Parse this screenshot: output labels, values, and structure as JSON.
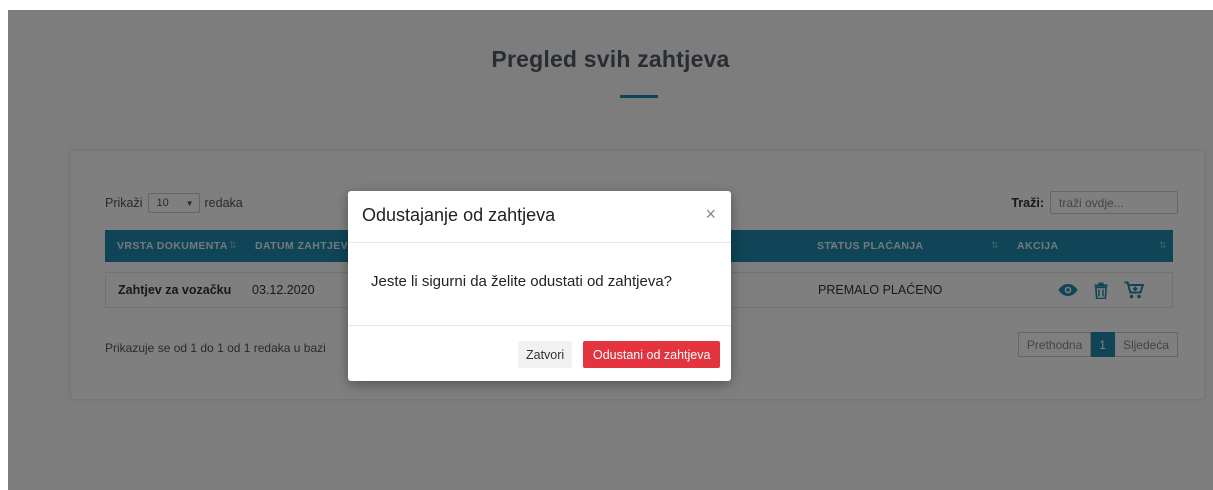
{
  "page": {
    "title": "Pregled svih zahtjeva"
  },
  "table": {
    "length": {
      "prefix": "Prikaži",
      "value": "10",
      "suffix": "redaka"
    },
    "search": {
      "label": "Traži:",
      "placeholder": "traži ovdje..."
    },
    "columns": [
      "VRSTA DOKUMENTA",
      "DATUM ZAHTJEVA",
      "STATUS PLAĆANJA",
      "AKCIJA"
    ],
    "rows": [
      {
        "document_type": "Zahtjev za vozačku",
        "date": "03.12.2020",
        "payment_status": "PREMALO PLAĆENO"
      }
    ],
    "info": "Prikazuje se od 1 do 1 od 1 redaka u bazi",
    "pagination": {
      "prev": "Prethodna",
      "current": "1",
      "next": "Sljedeća"
    }
  },
  "modal": {
    "title": "Odustajanje od zahtjeva",
    "close_symbol": "×",
    "body": "Jeste li sigurni da želite odustati od zahtjeva?",
    "close_button": "Zatvori",
    "confirm_button": "Odustani od zahtjeva"
  },
  "icons": {
    "view": "eye-icon",
    "delete": "trash-icon",
    "cart": "cart-icon"
  },
  "colors": {
    "header": "#1e8bad",
    "danger": "#e3343f",
    "accent": "#1f8bb0"
  }
}
